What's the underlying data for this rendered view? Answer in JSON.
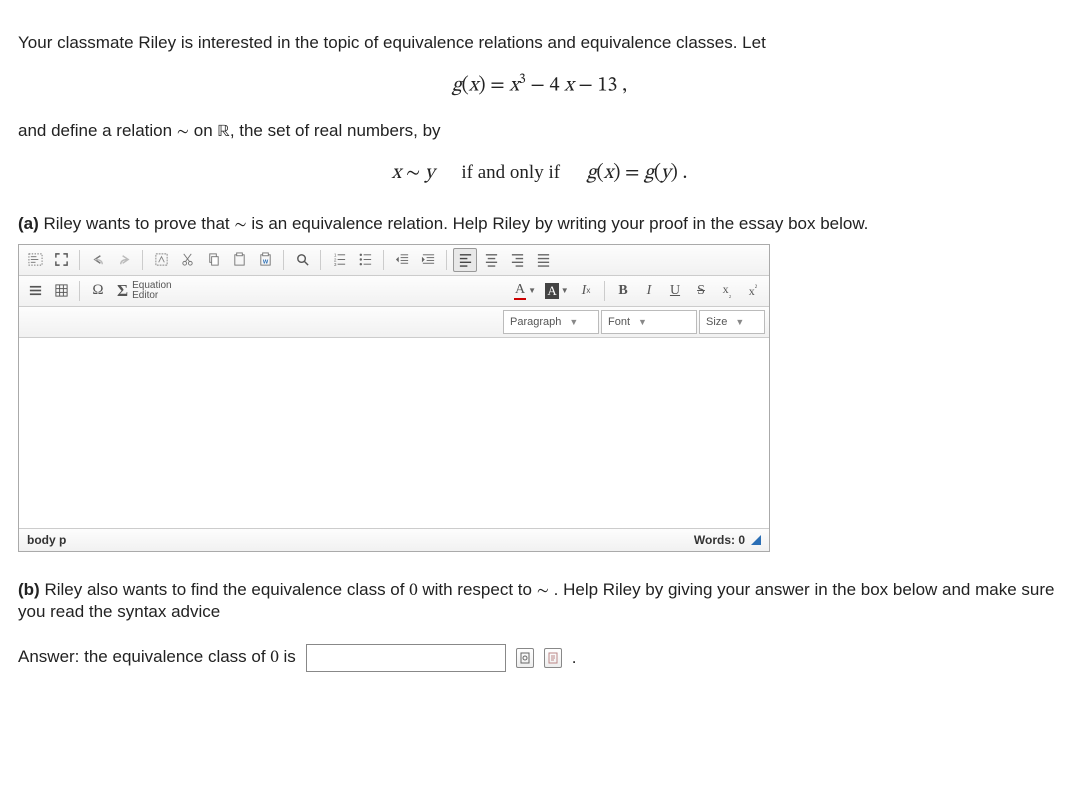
{
  "intro": {
    "line1_a": "Your classmate Riley is interested in the topic of equivalence relations and equivalence classes.  Let",
    "formula_g": "g(x) = x³ − 4 x − 13 ,",
    "line2_a": "and define a relation ",
    "tilde": "∼",
    "line2_b": " on ",
    "R": "ℝ",
    "line2_c": ", the set of real numbers, by",
    "rel_left": "x ∼ y",
    "rel_mid": "if and only if",
    "rel_right": "g(x) = g(y) ."
  },
  "partA": {
    "label": "(a)",
    "text_a": " Riley wants to prove that ",
    "tilde": "∼",
    "text_b": " is an equivalence relation. Help Riley by writing your proof in the essay box below."
  },
  "toolbar": {
    "eq_top": "Equation",
    "eq_bot": "Editor",
    "paragraph": "Paragraph",
    "font": "Font",
    "size": "Size"
  },
  "status": {
    "path": "body  p",
    "words": "Words: 0"
  },
  "partB": {
    "label": "(b)",
    "text_a": " Riley also wants to find the equivalence class of ",
    "zero1": "0",
    "text_b": " with respect to ",
    "tilde": "∼",
    "text_c": " . Help Riley by giving your answer in the box below and make sure you read the syntax advice",
    "answer_label_a": "Answer: the equivalence class of ",
    "zero2": "0",
    "answer_label_b": " is",
    "period": "."
  }
}
